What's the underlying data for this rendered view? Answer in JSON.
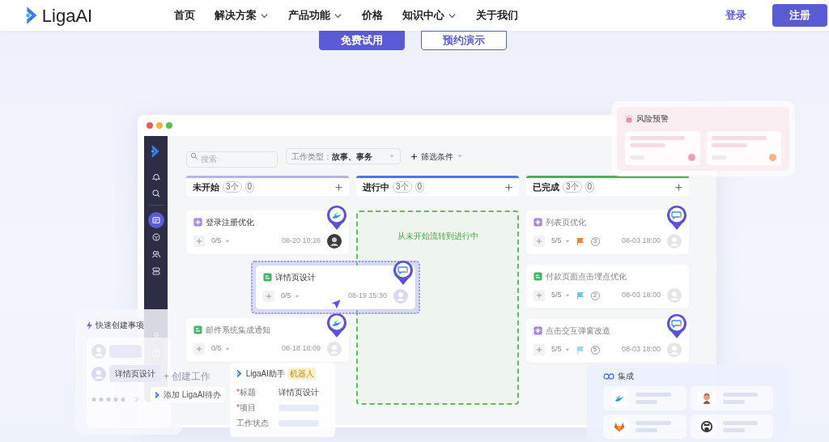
{
  "nav": {
    "brand": "LigaAI",
    "items": [
      {
        "label": "首页",
        "dropdown": false
      },
      {
        "label": "解决方案",
        "dropdown": true
      },
      {
        "label": "产品功能",
        "dropdown": true
      },
      {
        "label": "价格",
        "dropdown": false
      },
      {
        "label": "知识中心",
        "dropdown": true
      },
      {
        "label": "关于我们",
        "dropdown": false
      }
    ],
    "login": "登录",
    "signup": "注册"
  },
  "hero_buttons": [
    {
      "label": "免费试用",
      "kind": "primary"
    },
    {
      "label": "预约演示",
      "kind": "outline"
    }
  ],
  "sidebar": {
    "top": [
      {
        "kind": "bell",
        "selected": false
      },
      {
        "kind": "search",
        "selected": false
      },
      {
        "kind": "board",
        "selected": true
      },
      {
        "kind": "cube",
        "selected": false
      },
      {
        "kind": "users",
        "selected": false
      },
      {
        "kind": "stack",
        "selected": false
      }
    ],
    "bottom": [
      {
        "kind": "user"
      },
      {
        "kind": "help"
      }
    ]
  },
  "board": {
    "search": {
      "placeholder": "搜索"
    },
    "type_filter": {
      "label": "工作类型：",
      "value": "故事、事务"
    },
    "add_filter": "筛选条件",
    "columns": [
      {
        "title": "未开始",
        "count": "3个",
        "badge": "0",
        "color": "#b4b6e6",
        "cards": [
          {
            "kind": "story",
            "title": "登录注册优化",
            "progress": "0/5",
            "date": "08-20 10:26",
            "avatar": {
              "kind": "photo"
            },
            "pin": {
              "kind": "swoosh"
            },
            "faded": false
          },
          {
            "kind": "task",
            "title": "邮件系统集成通知",
            "progress": "0/5",
            "date": "08-18 18:09",
            "avatar": {
              "kind": "default"
            },
            "pin": {
              "kind": "swoosh"
            },
            "faded": true
          }
        ]
      },
      {
        "title": "进行中",
        "count": "3个",
        "badge": "0",
        "color": "#4a78e6",
        "drop_zone": "从未开始流转到进行中"
      },
      {
        "title": "已完成",
        "count": "3个",
        "badge": "0",
        "color": "#4caf50",
        "cards": [
          {
            "kind": "story",
            "title": "列表页优化",
            "progress": "5/5",
            "flag": {
              "color": "#e8833a"
            },
            "comments": "3",
            "date": "08-03 18:00",
            "avatar": {
              "kind": "default"
            },
            "pin": {
              "kind": "chat"
            },
            "faded": true
          },
          {
            "kind": "task",
            "title": "付款页面点击埋点优化",
            "progress": "5/5",
            "flag": {
              "color": "#6cc3e8"
            },
            "comments": "2",
            "date": "08-03 18:00",
            "avatar": {
              "kind": "default"
            },
            "faded": true
          },
          {
            "kind": "story",
            "title": "点击交互弹窗改造",
            "progress": "5/5",
            "flag": {
              "color": "#9fd8ec"
            },
            "comments": "5",
            "date": "08-03 18:00",
            "avatar": {
              "kind": "default"
            },
            "pin": {
              "kind": "chat"
            },
            "faded": true
          }
        ]
      }
    ],
    "dragged_card": {
      "kind": "task",
      "title": "详情页设计",
      "progress": "0/5",
      "date": "08-19 15:30",
      "avatar": {
        "kind": "lavender"
      },
      "pin": {
        "kind": "chat"
      }
    }
  },
  "risk_panel": {
    "title": "风险预警",
    "cards": [
      {
        "color": "#f0a0b4"
      },
      {
        "color": "#f5b487"
      }
    ]
  },
  "quick_create": {
    "title": "快速创建事项",
    "messages": [
      {
        "kind": "skeleton"
      },
      {
        "kind": "text",
        "text": "详情页设计"
      }
    ]
  },
  "create_work": "+ 创建工作",
  "add_todo": "添加 LigaAI待办",
  "assistant": {
    "name": "LigaAI助手",
    "tag": "机器人",
    "fields": [
      {
        "mark": "*",
        "label": "标题",
        "value": "详情页设计"
      },
      {
        "mark": "*",
        "label": "项目"
      },
      {
        "label": "工作状态"
      }
    ]
  },
  "integration": {
    "title": "集成",
    "apps": [
      {
        "kind": "swoosh"
      },
      {
        "kind": "butler"
      },
      {
        "kind": "fox"
      },
      {
        "kind": "octocat"
      }
    ]
  }
}
